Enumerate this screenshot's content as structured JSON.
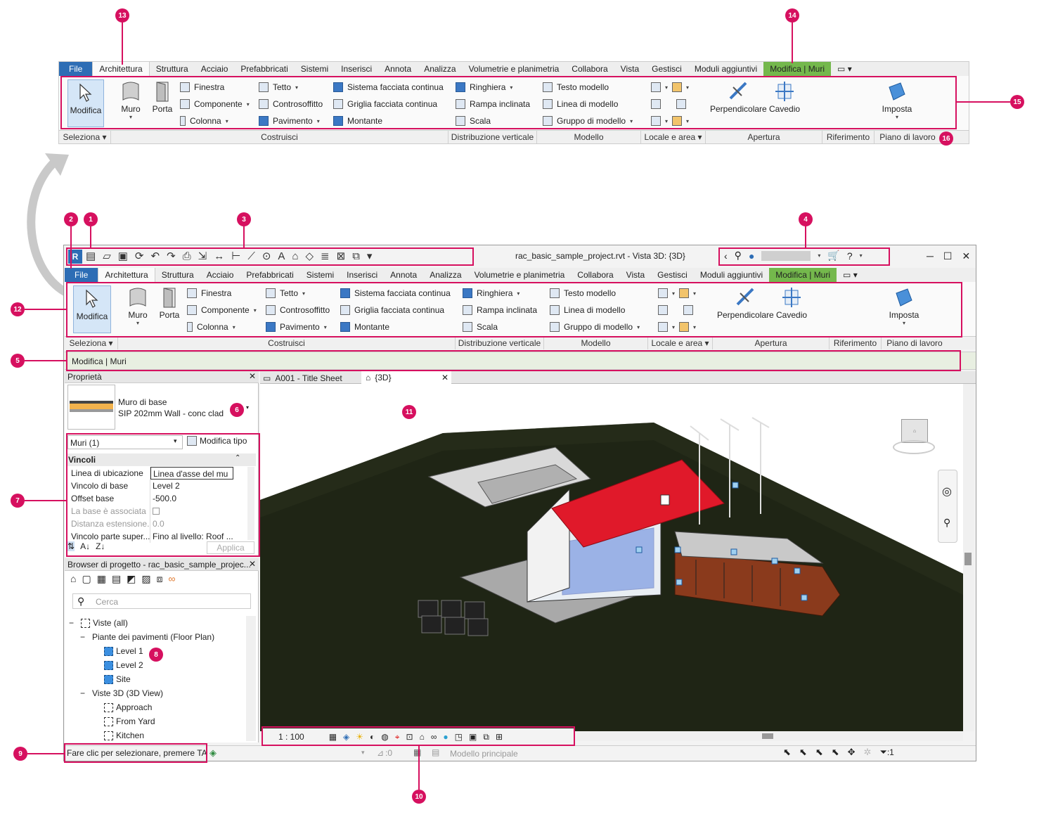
{
  "callouts": [
    "1",
    "2",
    "3",
    "4",
    "5",
    "6",
    "7",
    "8",
    "9",
    "10",
    "11",
    "12",
    "13",
    "14",
    "15",
    "16"
  ],
  "colors": {
    "accent": "#d6105f",
    "file_tab": "#2d6db5",
    "modify_tab": "#74b84c",
    "roof": "#e0192a",
    "viewport_bg": "#ffffff"
  },
  "ribbon_top": {
    "tabs": [
      "File",
      "Architettura",
      "Struttura",
      "Acciaio",
      "Prefabbricati",
      "Sistemi",
      "Inserisci",
      "Annota",
      "Analizza",
      "Volumetrie e planimetria",
      "Collabora",
      "Vista",
      "Gestisci",
      "Moduli aggiuntivi",
      "Modifica | Muri"
    ]
  },
  "ribbon": {
    "modifica": "Modifica",
    "muro": "Muro",
    "porta": "Porta",
    "finestra": "Finestra",
    "componente": "Componente",
    "colonna": "Colonna",
    "tetto": "Tetto",
    "controsoffitto": "Controsoffitto",
    "pavimento": "Pavimento",
    "sistema_facciata": "Sistema facciata continua",
    "griglia_facciata": "Griglia facciata continua",
    "montante": "Montante",
    "ringhiera": "Ringhiera",
    "rampa": "Rampa inclinata",
    "scala": "Scala",
    "testo_modello": "Testo modello",
    "linea_modello": "Linea di modello",
    "gruppo_modello": "Gruppo di modello",
    "perpendicolare": "Perpendicolare",
    "cavedio": "Cavedio",
    "imposta": "Imposta",
    "panels": [
      "Seleziona",
      "Costruisci",
      "Distribuzione verticale",
      "Modello",
      "Locale e area",
      "Apertura",
      "Riferimento",
      "Piano di lavoro"
    ]
  },
  "title_bar": {
    "title": "rac_basic_sample_project.rvt - Vista 3D: {3D}"
  },
  "options_bar": "Modifica | Muri",
  "properties": {
    "header": "Proprietà",
    "type_family": "Muro di base",
    "type_name": "SIP 202mm Wall - conc clad",
    "selector": "Muri (1)",
    "edit_type": "Modifica tipo",
    "section": "Vincoli",
    "rows": [
      {
        "k": "Linea di ubicazione",
        "v": "Linea d'asse del mu"
      },
      {
        "k": "Vincolo di base",
        "v": "Level 2"
      },
      {
        "k": "Offset base",
        "v": "-500.0"
      },
      {
        "k": "La base è associata",
        "v": ""
      },
      {
        "k": "Distanza estensione...",
        "v": "0.0"
      },
      {
        "k": "Vincolo parte super...",
        "v": "Fino al livello: Roof ..."
      }
    ],
    "apply": "Applica"
  },
  "browser": {
    "header": "Browser di progetto - rac_basic_sample_projec...",
    "search_placeholder": "Cerca",
    "items": [
      "Viste (all)",
      "Piante dei pavimenti (Floor Plan)",
      "Level 1",
      "Level 2",
      "Site",
      "Viste 3D (3D View)",
      "Approach",
      "From Yard",
      "Kitchen"
    ]
  },
  "doc_tabs": [
    "A001 - Title Sheet",
    "{3D}"
  ],
  "view_bar": {
    "scale": "1 : 100"
  },
  "status": {
    "text": "Fare clic per selezionare, premere TAE",
    "count": ":0",
    "model": "Modello principale",
    "filter": ":1"
  }
}
